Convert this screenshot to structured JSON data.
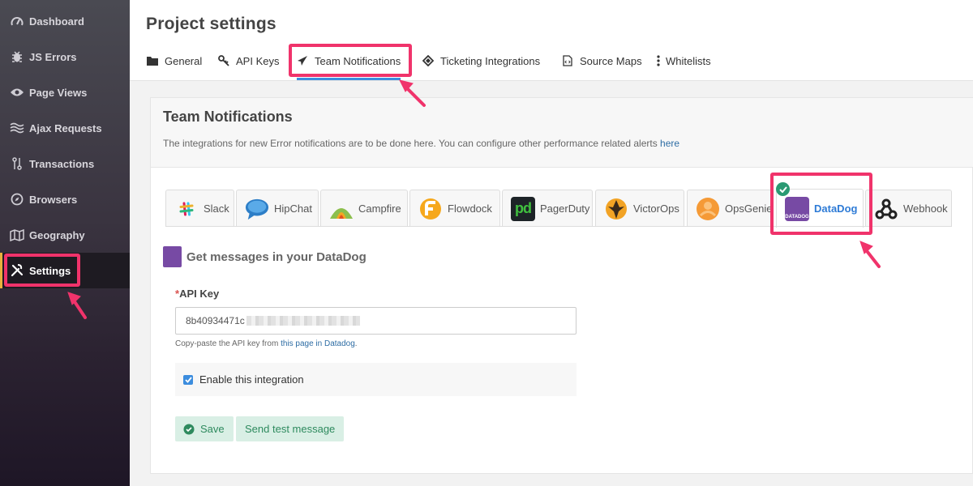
{
  "sidebar": {
    "items": [
      {
        "label": "Dashboard",
        "icon": "speedometer-icon"
      },
      {
        "label": "JS Errors",
        "icon": "bug-icon"
      },
      {
        "label": "Page Views",
        "icon": "eye-icon"
      },
      {
        "label": "Ajax Requests",
        "icon": "waves-icon"
      },
      {
        "label": "Transactions",
        "icon": "transactions-icon"
      },
      {
        "label": "Browsers",
        "icon": "compass-icon"
      },
      {
        "label": "Geography",
        "icon": "map-icon"
      },
      {
        "label": "Settings",
        "icon": "tools-icon"
      }
    ],
    "active": "Settings"
  },
  "header": {
    "title": "Project settings",
    "tabs": [
      {
        "label": "General",
        "icon": "folder-icon"
      },
      {
        "label": "API Keys",
        "icon": "key-icon"
      },
      {
        "label": "Team Notifications",
        "icon": "paper-plane-icon"
      },
      {
        "label": "Ticketing Integrations",
        "icon": "ticket-icon"
      },
      {
        "label": "Source Maps",
        "icon": "file-code-icon"
      },
      {
        "label": "Whitelists",
        "icon": "more-vertical-icon"
      }
    ],
    "active_tab": "Team Notifications"
  },
  "card": {
    "title": "Team Notifications",
    "description": "The integrations for new Error notifications are to be done here. You can configure other performance related alerts",
    "description_link": "here"
  },
  "integrations": {
    "tabs": [
      {
        "label": "Slack",
        "icon": "slack-logo"
      },
      {
        "label": "HipChat",
        "icon": "hipchat-logo"
      },
      {
        "label": "Campfire",
        "icon": "campfire-logo"
      },
      {
        "label": "Flowdock",
        "icon": "flowdock-logo"
      },
      {
        "label": "PagerDuty",
        "icon": "pagerduty-logo",
        "logo_text": "pd"
      },
      {
        "label": "VictorOps",
        "icon": "victorops-logo"
      },
      {
        "label": "OpsGenie",
        "icon": "opsgenie-logo"
      },
      {
        "label": "DataDog",
        "icon": "datadog-logo",
        "logo_text": "DATADOG"
      },
      {
        "label": "Webhook",
        "icon": "webhook-logo"
      }
    ],
    "active": "DataDog"
  },
  "form": {
    "section_title": "Get messages in your DataDog",
    "api_key_required_mark": "*",
    "api_key_label": "API Key",
    "api_key_value": "8b40934471c",
    "hint_text": "Copy-paste the API key from",
    "hint_link": "this page in Datadog",
    "hint_end": ".",
    "enable_label": "Enable this integration",
    "enable_checked": true,
    "save_label": "Save",
    "test_label": "Send test message"
  },
  "colors": {
    "highlight": "#f0336b",
    "accent": "#3c8dde",
    "datadog": "#774aa4",
    "success_bg": "#d9efe5",
    "success_text": "#2e8a5e"
  }
}
